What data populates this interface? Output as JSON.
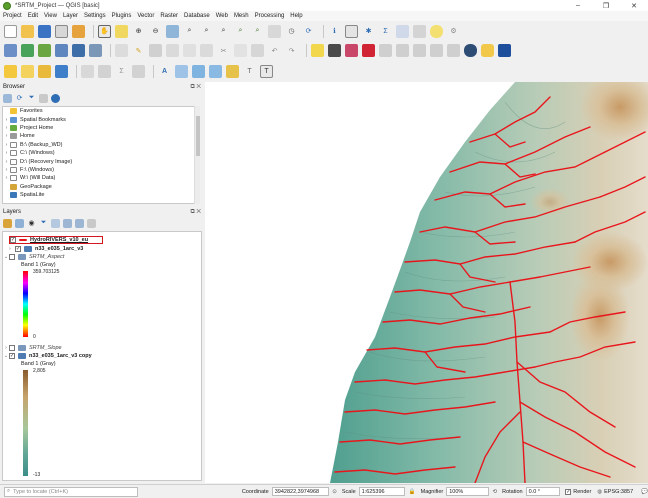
{
  "window": {
    "title": "*SRTM_Project — QGIS [basic]",
    "controls": [
      "–",
      "❐",
      "✕"
    ]
  },
  "menu": [
    "Project",
    "Edit",
    "View",
    "Layer",
    "Settings",
    "Plugins",
    "Vector",
    "Raster",
    "Database",
    "Web",
    "Mesh",
    "Processing",
    "Help"
  ],
  "browser": {
    "title": "Browser",
    "panel_buttons": "⧉ ✕",
    "items": [
      {
        "label": "Favorites",
        "icon": "star-icon"
      },
      {
        "label": "Spatial Bookmarks",
        "icon": "bookmark-icon"
      },
      {
        "label": "Project Home",
        "icon": "folder-green-icon"
      },
      {
        "label": "Home",
        "icon": "home-icon"
      },
      {
        "label": "B:\\ (Backup_WD)",
        "icon": "drive-icon"
      },
      {
        "label": "C:\\ (Windows)",
        "icon": "drive-icon"
      },
      {
        "label": "D:\\ (Recovery Image)",
        "icon": "drive-icon"
      },
      {
        "label": "F:\\ (Windows)",
        "icon": "drive-icon"
      },
      {
        "label": "W:\\ (Will Data)",
        "icon": "drive-icon"
      },
      {
        "label": "GeoPackage",
        "icon": "geopackage-icon"
      },
      {
        "label": "SpatiaLite",
        "icon": "spatialite-icon"
      }
    ]
  },
  "layers": {
    "title": "Layers",
    "panel_buttons": "⧉ ✕",
    "items": [
      {
        "label": "HydroRIVERS_v10_eu",
        "checked": true,
        "selected": true
      },
      {
        "label": "n33_e035_1arc_v3",
        "checked": true
      },
      {
        "label": "SRTM_Aspect",
        "checked": false,
        "band": "Band 1 (Gray)",
        "max": "359.703125",
        "min": "0"
      },
      {
        "label": "SRTM_Slope",
        "checked": false
      },
      {
        "label": "n33_e035_1arc_v3 copy",
        "checked": true,
        "band": "Band 1 (Gray)",
        "max": "2,805",
        "min": "-13"
      }
    ]
  },
  "status": {
    "search_placeholder": "Type to locate (Ctrl+K)",
    "coordinate_label": "Coordinate",
    "coordinate_value": "3942822,3974968",
    "scale_label": "Scale",
    "scale_value": "1:625396",
    "magnifier_label": "Magnifier",
    "magnifier_value": "100%",
    "rotation_label": "Rotation",
    "rotation_value": "0.0 °",
    "render_label": "Render",
    "crs": "EPSG:3857"
  },
  "colors": {
    "river": "#e8161c",
    "selection_box": "#d6161e",
    "hillshade_green": "#7fb8a8"
  }
}
